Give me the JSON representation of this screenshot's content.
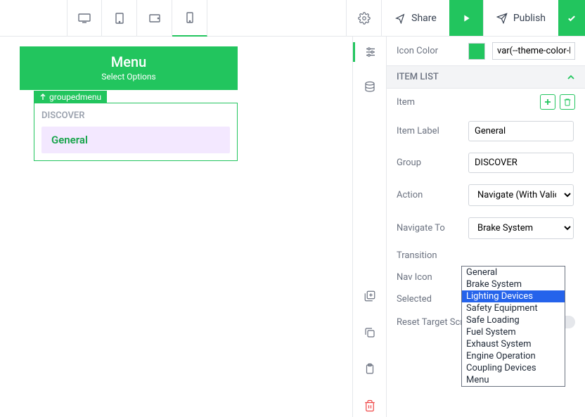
{
  "toolbar": {
    "share_label": "Share",
    "publish_label": "Publish"
  },
  "preview": {
    "menu_title": "Menu",
    "menu_subtitle": "Select Options",
    "widget_tag": "groupedmenu",
    "group_label": "DISCOVER",
    "group_item": "General"
  },
  "panel": {
    "icon_color_label": "Icon Color",
    "icon_color_value": "var(--theme-color-ba",
    "section_title": "ITEM LIST",
    "item_label": "Item",
    "item_label_field": "Item Label",
    "item_label_value": "General",
    "group_field": "Group",
    "group_value": "DISCOVER",
    "action_field": "Action",
    "action_value": "Navigate (With Validation)",
    "navigate_field": "Navigate To",
    "navigate_value": "Brake System",
    "transition_field": "Transition",
    "navicon_field": "Nav Icon",
    "selected_field": "Selected",
    "reset_field": "Reset Target Screen"
  },
  "dropdown": {
    "options": [
      "General",
      "Brake System",
      "Lighting Devices",
      "Safety Equipment",
      "Safe Loading",
      "Fuel System",
      "Exhaust System",
      "Engine Operation",
      "Coupling Devices",
      "Menu"
    ],
    "highlighted": "Lighting Devices"
  }
}
